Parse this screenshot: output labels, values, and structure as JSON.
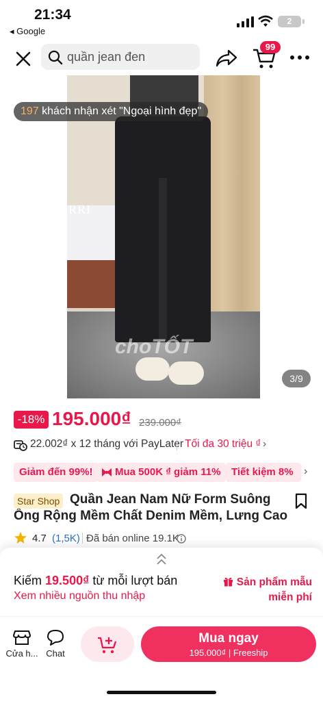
{
  "status_bar": {
    "time": "21:34",
    "back_app": "◂ Google",
    "battery": "2"
  },
  "search": {
    "value": "quần jean đen"
  },
  "cart": {
    "badge": "99"
  },
  "hero": {
    "review_count": "197",
    "review_text": "khách nhận xét \"Ngoại hình đẹp\"",
    "counter": "3/9",
    "photo_text": "RRI",
    "watermark": "choTỐT"
  },
  "price": {
    "discount": "-18%",
    "current": "195.000₫",
    "original": "239.000₫"
  },
  "paylater": {
    "text": "22.002₫ x 12 tháng với PayLater",
    "link": "Tối đa 30 triệu ₫"
  },
  "promos": [
    {
      "label": "Giảm đến 99%!"
    },
    {
      "label": "Mua 500K ₫ giảm 11%"
    },
    {
      "label": "Tiết kiệm 8%"
    }
  ],
  "product": {
    "shop_badge": "Star Shop",
    "title": "Quần Jean Nam Nữ Form Suông Ống Rộng Mềm Chất Denim Mềm, Lưng Cao Hac...",
    "rating": "4.7",
    "reviews": "(1,5K)",
    "sold": "Đã bán online 19.1K"
  },
  "earn": {
    "prefix": "Kiếm",
    "amount": "19.500₫",
    "suffix": "từ mỗi lượt bán",
    "link": "Xem nhiều nguồn thu nhập",
    "sample": "Sản phẩm mẫu miễn phí"
  },
  "bottom": {
    "store_label": "Cửa h...",
    "chat_label": "Chat",
    "buy_label": "Mua ngay",
    "buy_price": "195.000₫",
    "buy_ship": "Freeship"
  },
  "colors": {
    "accent": "#e8194a",
    "buy": "#f0305f",
    "promo_bg": "#fde8ee"
  }
}
